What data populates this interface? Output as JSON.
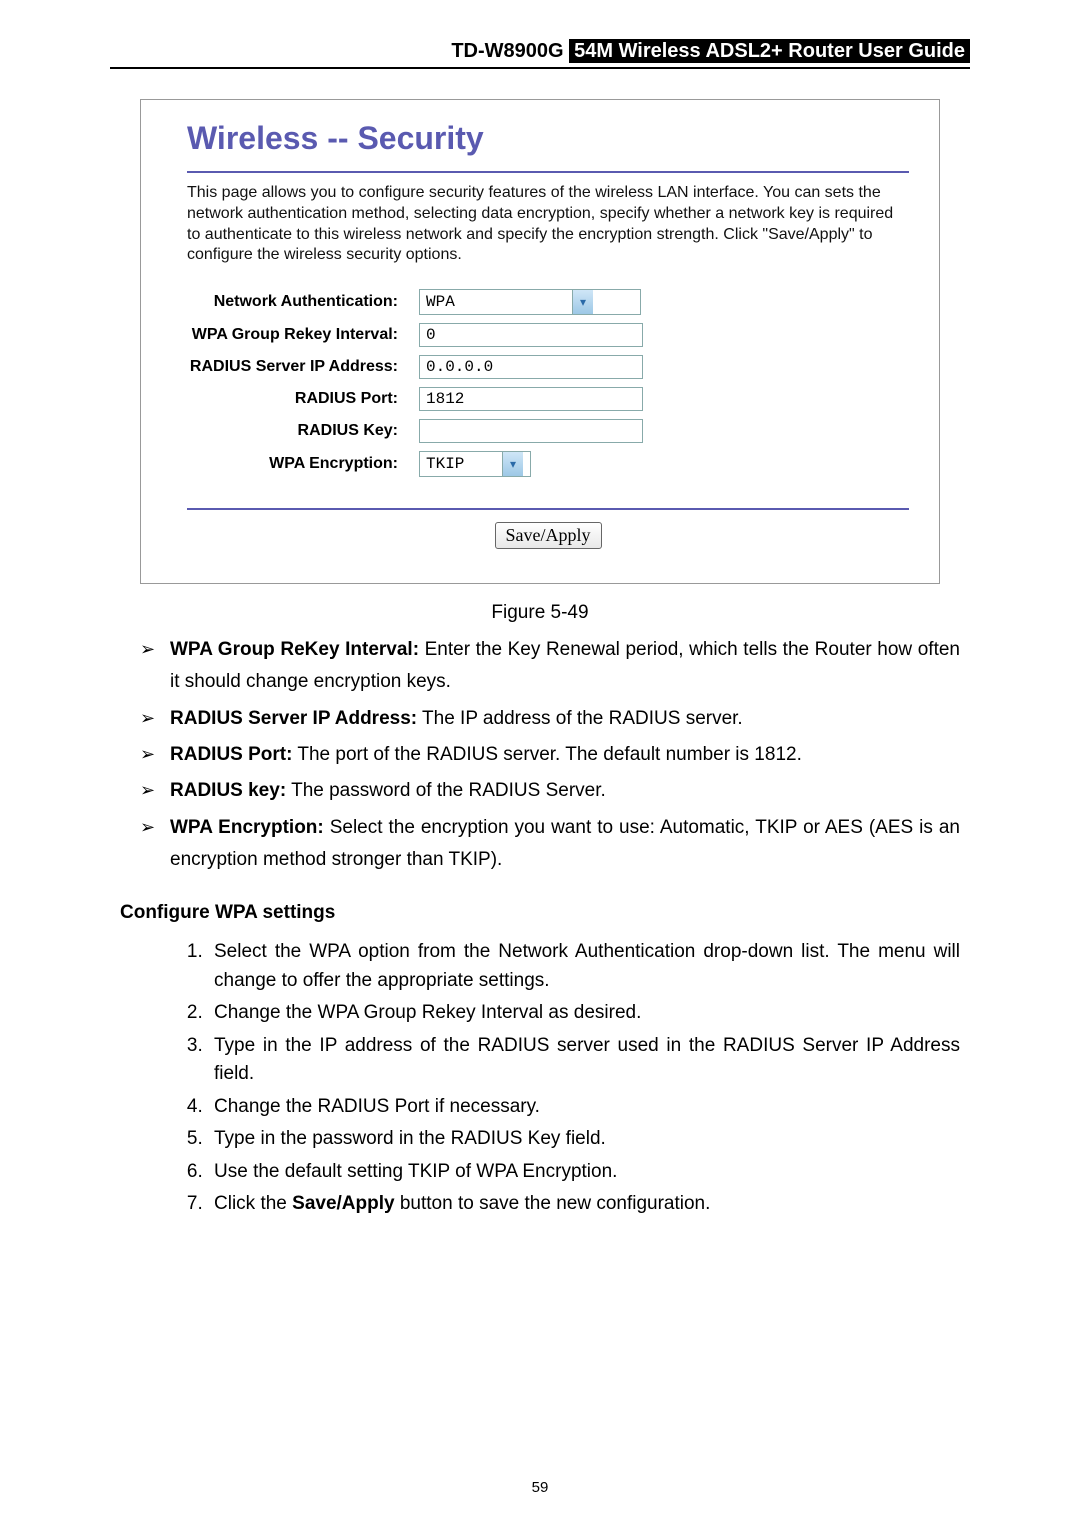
{
  "header": {
    "model": "TD-W8900G",
    "tag": "54M  Wireless  ADSL2+  Router  User  Guide"
  },
  "screenshot": {
    "title": "Wireless -- Security",
    "desc": "This page allows you to configure security features of the wireless LAN interface. You can sets the network authentication method, selecting data encryption, specify whether a network key is required to authenticate to this wireless network and specify the encryption strength. Click \"Save/Apply\" to configure the wireless security options.",
    "labels": {
      "netauth": "Network Authentication:",
      "rekey": "WPA Group Rekey Interval:",
      "radiusip": "RADIUS Server IP Address:",
      "radiusport": "RADIUS Port:",
      "radiuskey": "RADIUS Key:",
      "wpaenc": "WPA Encryption:"
    },
    "values": {
      "netauth": "WPA",
      "rekey": "0",
      "radiusip": "0.0.0.0",
      "radiusport": "1812",
      "radiuskey": "",
      "wpaenc": "TKIP"
    },
    "button": "Save/Apply"
  },
  "figure_caption": "Figure 5-49",
  "bullets": [
    {
      "term": "WPA Group ReKey Interval:",
      "text": " Enter the Key Renewal period, which tells the Router how often it should change encryption keys."
    },
    {
      "term": "RADIUS Server IP Address:",
      "text": " The IP address of the RADIUS server."
    },
    {
      "term": "RADIUS Port:",
      "text": " The port of the RADIUS server. The default number is 1812."
    },
    {
      "term": "RADIUS key:",
      "text": " The password of the RADIUS Server."
    },
    {
      "term": "WPA Encryption:",
      "text": " Select the encryption you want to use: Automatic, TKIP or AES (AES is an encryption method stronger than TKIP)."
    }
  ],
  "section_head": "Configure WPA settings",
  "steps": [
    "Select the WPA option from the Network Authentication drop-down list. The menu will change to offer the appropriate settings.",
    "Change the WPA Group Rekey Interval as desired.",
    "Type in the IP address of the RADIUS server used in the RADIUS Server IP Address field.",
    "Change the RADIUS Port if necessary.",
    "Type in the password in the RADIUS Key field.",
    "Use the default setting TKIP of WPA Encryption.",
    {
      "pre": "Click the ",
      "bold": "Save/Apply",
      "post": " button to save the new configuration."
    }
  ],
  "page_number": "59"
}
